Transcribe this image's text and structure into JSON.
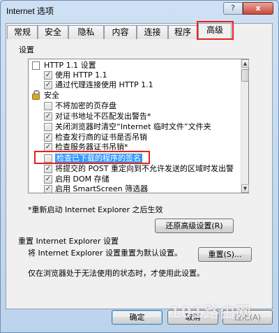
{
  "window": {
    "title": "Internet 选项",
    "help_label": "?",
    "close_label": "x"
  },
  "tabs": [
    {
      "label": "常规"
    },
    {
      "label": "安全"
    },
    {
      "label": "隐私"
    },
    {
      "label": "内容"
    },
    {
      "label": "连接"
    },
    {
      "label": "程序"
    },
    {
      "label": "高级",
      "active": true
    }
  ],
  "settings": {
    "group_label": "设置",
    "items": [
      {
        "text": "HTTP 1.1 设置",
        "icon": "document-icon",
        "checkbox": false
      },
      {
        "text": "使用 HTTP 1.1",
        "checked": true
      },
      {
        "text": "通过代理连接使用 HTTP 1.1",
        "checked": true
      },
      {
        "text": "安全",
        "icon": "lock-icon",
        "checkbox": false
      },
      {
        "text": "不将加密的页存盘",
        "checked": false
      },
      {
        "text": "对证书地址不匹配发出警告*",
        "checked": true
      },
      {
        "text": "关闭浏览器时清空“Internet 临时文件”文件夹",
        "checked": false
      },
      {
        "text": "检查发行商的证书是否吊销",
        "checked": true
      },
      {
        "text": "检查服务器证书吊销*",
        "checked": true
      },
      {
        "text": "检查已下载的程序的签名",
        "checked": false,
        "selected": true
      },
      {
        "text": "将提交的 POST 重定向到不允许发送的区域时发出警",
        "checked": true
      },
      {
        "text": "启用 DOM 存储",
        "checked": true
      },
      {
        "text": "启用 SmartScreen 筛选器",
        "checked": true
      }
    ],
    "restart_note": "*重新启动 Internet Explorer 之后生效",
    "restore_button": "还原高级设置(R)"
  },
  "reset": {
    "section_label": "重置 Internet Explorer 设置",
    "description": "将 Internet Explorer 设置重置为默认设置。",
    "reset_button": "重置(S)...",
    "condition_text": "仅在浏览器处于无法使用的状态时，才使用此设置。"
  },
  "footer": {
    "ok": "确定",
    "cancel": "取消",
    "apply": "应用(A)"
  },
  "watermark": "101路由网",
  "colors": {
    "highlight_box": "#e8201a",
    "selection": "#3399ff"
  }
}
